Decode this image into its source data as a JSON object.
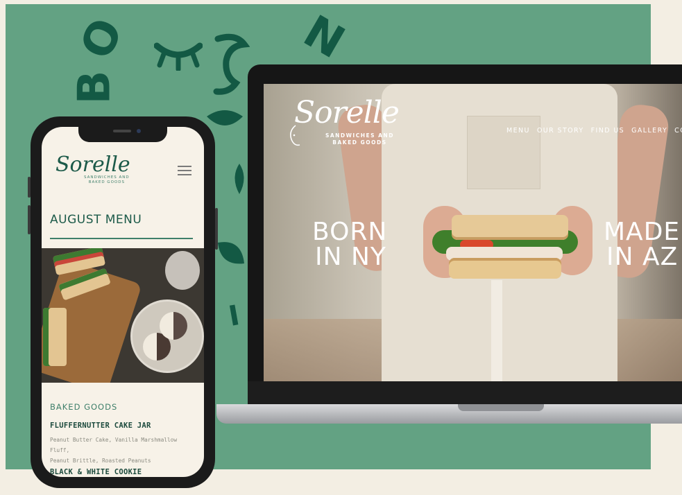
{
  "backdrop": {
    "color": "#63a283",
    "ring_letters": [
      "B",
      "O",
      "N",
      "I"
    ]
  },
  "laptop": {
    "brand": {
      "name": "Sorelle",
      "tagline_line1": "SANDWICHES AND",
      "tagline_line2": "BAKED GOODS"
    },
    "nav": [
      "MENU",
      "OUR STORY",
      "FIND US",
      "GALLERY",
      "CO"
    ],
    "hero": {
      "left_line1": "BORN",
      "left_line2": "IN NY",
      "right_line1": "MADE",
      "right_line2": "IN AZ"
    }
  },
  "phone": {
    "brand": {
      "name": "Sorelle",
      "tagline_line1": "SANDWICHES AND",
      "tagline_line2": "BAKED GOODS"
    },
    "menu_icon": "hamburger-icon",
    "heading": "AUGUST MENU",
    "section": "BAKED GOODS",
    "items": [
      {
        "title": "FLUFFERNUTTER CAKE JAR",
        "desc_line1": "Peanut Butter Cake, Vanilla Marshmallow Fluff,",
        "desc_line2": "Peanut Brittle, Roasted Peanuts"
      },
      {
        "title": "BLACK & WHITE COOKIE"
      }
    ]
  },
  "colors": {
    "brand_green": "#1c5a49",
    "accent_green": "#3e7f6a",
    "cream": "#f7f2e8"
  }
}
